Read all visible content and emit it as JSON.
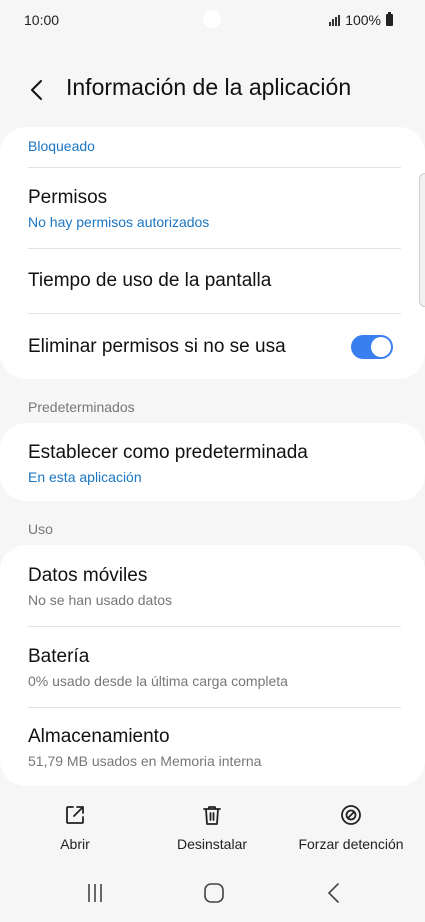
{
  "status_bar": {
    "time": "10:00",
    "battery": "100%"
  },
  "header": {
    "title": "Información de la aplicación"
  },
  "card1": {
    "top_status": "Bloqueado",
    "permissions_title": "Permisos",
    "permissions_sub": "No hay permisos autorizados",
    "screen_time_title": "Tiempo de uso de la pantalla",
    "remove_perms_title": "Eliminar permisos si no se usa",
    "remove_perms_enabled": true
  },
  "section_defaults": "Predeterminados",
  "card2": {
    "set_default_title": "Establecer como predeterminada",
    "set_default_sub": "En esta aplicación"
  },
  "section_usage": "Uso",
  "card3": {
    "mobile_data_title": "Datos móviles",
    "mobile_data_sub": "No se han usado datos",
    "battery_title": "Batería",
    "battery_sub": "0% usado desde la última carga completa",
    "storage_title": "Almacenamiento",
    "storage_sub": "51,79 MB usados en Memoria interna"
  },
  "actions": {
    "open": "Abrir",
    "uninstall": "Desinstalar",
    "force_stop": "Forzar detención"
  },
  "colors": {
    "accent": "#1b76c4",
    "toggle": "#3a7ff0"
  }
}
